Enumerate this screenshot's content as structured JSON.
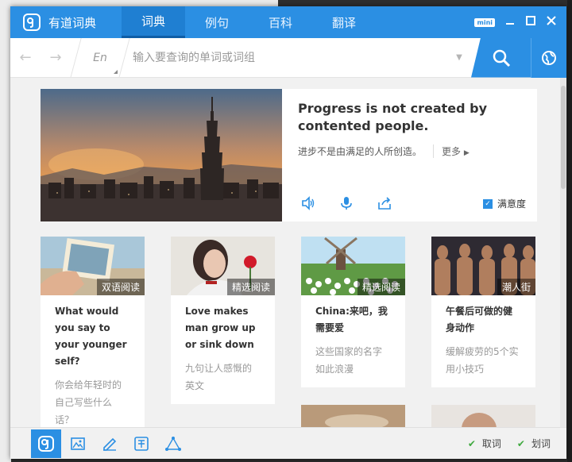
{
  "app": {
    "name": "有道词典",
    "logo_glyph": "Ꮼ"
  },
  "nav": {
    "tabs": [
      {
        "label": "词典",
        "active": true
      },
      {
        "label": "例句",
        "active": false
      },
      {
        "label": "百科",
        "active": false
      },
      {
        "label": "翻译",
        "active": false
      }
    ]
  },
  "window_controls": {
    "mini_label": "mini",
    "minimize": "▬",
    "maximize": "▭",
    "close": "✕"
  },
  "search": {
    "back": "←",
    "forward": "→",
    "lang": "En",
    "placeholder": "输入要查询的单词或词组",
    "value": "",
    "caret": "▼"
  },
  "daily": {
    "sentence_en": "Progress is not created by contented people.",
    "sentence_cn": "进步不是由满足的人所创造。",
    "more": "更多",
    "satisfy_label": "满意度",
    "satisfy_checked": true
  },
  "cards": [
    {
      "tag": "双语阅读",
      "title": "What would you say to your younger self?",
      "subtitle": "你会给年轻时的自己写些什么话？"
    },
    {
      "tag": "精选阅读",
      "title": "Love makes man grow up or sink down",
      "subtitle": "九句让人感慨的英文"
    },
    {
      "tag": "精选阅读",
      "title": "China:来吧，我需要爱",
      "subtitle": "这些国家的名字如此浪漫"
    },
    {
      "tag": "潮人街",
      "title": "午餐后可做的健身动作",
      "subtitle": "缓解疲劳的5个实用小技巧"
    }
  ],
  "bottom": {
    "option1": "取词",
    "option2": "划词"
  },
  "colors": {
    "accent": "#2b8fe3",
    "tick": "#3fa93f"
  }
}
